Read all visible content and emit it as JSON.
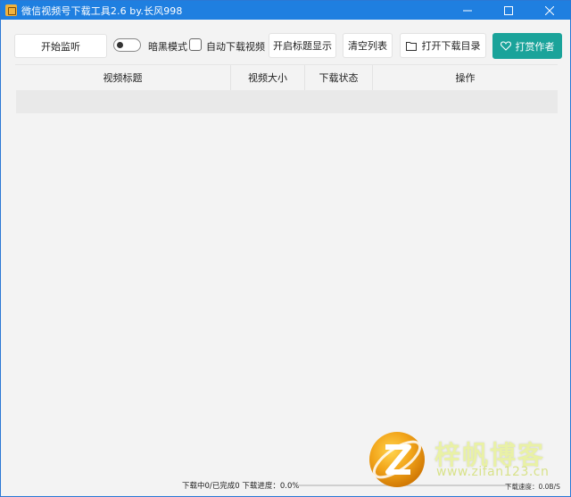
{
  "window": {
    "title": "微信视频号下载工具2.6 by.长风998",
    "controls": [
      "minimize-icon",
      "maximize-icon",
      "close-icon"
    ]
  },
  "toolbar": {
    "start_label": "开始监听",
    "dark_mode_label": "暗黑模式",
    "auto_download_label": "自动下载视频",
    "title_display_label": "开启标题显示",
    "clear_list_label": "清空列表",
    "open_dir_label": "打开下载目录",
    "tip_author_label": "打赏作者",
    "dark_mode_on": false,
    "auto_download_checked": false
  },
  "table": {
    "columns": [
      "视频标题",
      "视频大小",
      "下载状态",
      "操作"
    ],
    "rows": []
  },
  "status": {
    "summary": "下载中0/已完成0  下载进度：0.0%",
    "progress": 0,
    "speed": "下载速度：0.0B/S"
  },
  "watermark": {
    "title": "梓帆博客",
    "url": "www.zifan123.cn"
  },
  "colors": {
    "titlebar": "#1f7fe0",
    "accent": "#1aa39a"
  }
}
